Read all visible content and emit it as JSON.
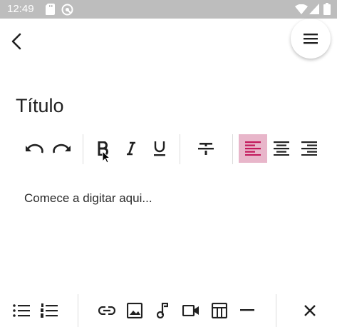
{
  "status_bar": {
    "time": "12:49",
    "icons": [
      "sd-card-icon",
      "sync-icon",
      "wifi-icon",
      "signal-icon",
      "battery-icon"
    ]
  },
  "app_bar": {
    "back_icon": "arrow-back-icon",
    "menu_icon": "menu-icon"
  },
  "document": {
    "title": "Título",
    "placeholder": "Comece a digitar aqui..."
  },
  "format_toolbar": {
    "buttons": [
      "undo",
      "redo",
      "bold",
      "italic",
      "underline",
      "strikethrough",
      "align-left",
      "align-center",
      "align-right"
    ],
    "active": "align-left"
  },
  "insert_toolbar": {
    "buttons": [
      "bulleted-list",
      "numbered-list",
      "link",
      "image",
      "audio",
      "video",
      "table",
      "horizontal-rule",
      "close"
    ]
  },
  "colors": {
    "active_highlight": "#e8b6ca",
    "active_icon": "#c2185b",
    "status_bar": "#bdbdbd"
  }
}
